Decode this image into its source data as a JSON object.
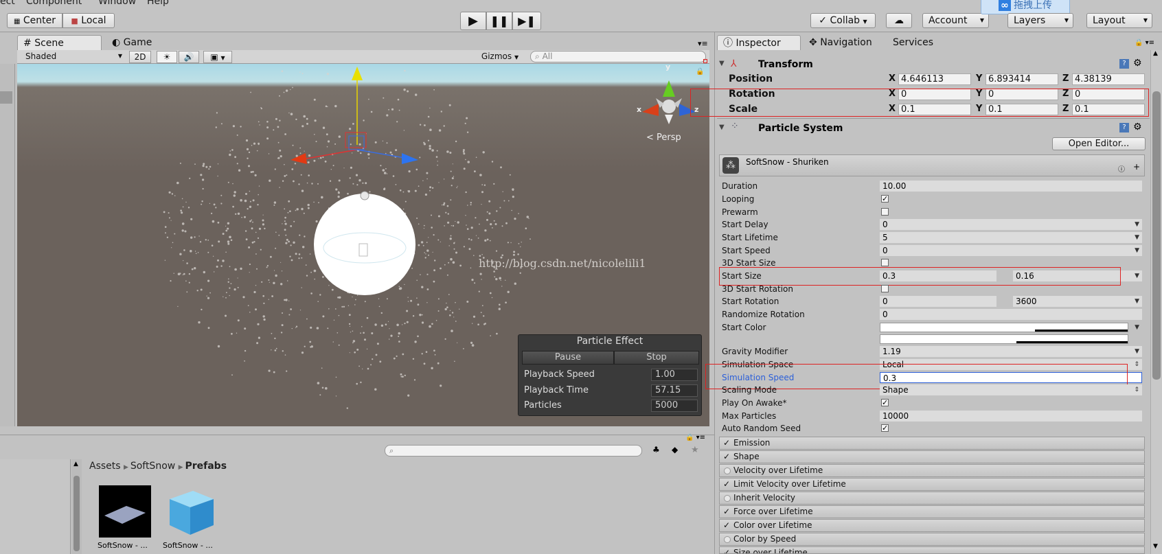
{
  "menubar": {
    "items": [
      "ect",
      "Component",
      "Window",
      "Help"
    ]
  },
  "toolbar": {
    "center_label": "Center",
    "local_label": "Local",
    "collab_label": "Collab",
    "account_label": "Account",
    "layers_label": "Layers",
    "layout_label": "Layout",
    "upload_overlay": "拖拽上传"
  },
  "scene_panel": {
    "tabs": {
      "scene": "Scene",
      "game": "Game"
    },
    "shading": "Shaded",
    "mode_2d": "2D",
    "gizmos": "Gizmos",
    "search_placeholder": "All",
    "persp_label": "Persp",
    "axis_x": "x",
    "axis_y": "y",
    "axis_z": "z",
    "watermark": "http://blog.csdn.net/nicolelili1"
  },
  "particle_effect": {
    "title": "Particle Effect",
    "pause": "Pause",
    "stop": "Stop",
    "rows": [
      {
        "label": "Playback Speed",
        "value": "1.00"
      },
      {
        "label": "Playback Time",
        "value": "57.15"
      },
      {
        "label": "Particles",
        "value": "5000"
      }
    ]
  },
  "project": {
    "breadcrumb": [
      "Assets",
      "SoftSnow",
      "Prefabs"
    ],
    "assets": [
      {
        "name": "SoftSnow - ..."
      },
      {
        "name": "SoftSnow - ..."
      }
    ]
  },
  "inspector": {
    "tabs": {
      "inspector": "Inspector",
      "navigation": "Navigation",
      "services": "Services"
    },
    "transform": {
      "title": "Transform",
      "rows": [
        {
          "label": "Position",
          "x": "4.646113",
          "y": "6.893414",
          "z": "4.38139"
        },
        {
          "label": "Rotation",
          "x": "0",
          "y": "0",
          "z": "0"
        },
        {
          "label": "Scale",
          "x": "0.1",
          "y": "0.1",
          "z": "0.1"
        }
      ]
    },
    "particle_system": {
      "title": "Particle System",
      "open_editor": "Open Editor...",
      "subheader": "SoftSnow - Shuriken",
      "duration": {
        "label": "Duration",
        "value": "10.00"
      },
      "looping": {
        "label": "Looping"
      },
      "prewarm": {
        "label": "Prewarm"
      },
      "start_delay": {
        "label": "Start Delay",
        "value": "0"
      },
      "start_lifetime": {
        "label": "Start Lifetime",
        "value": "5"
      },
      "start_speed": {
        "label": "Start Speed",
        "value": "0"
      },
      "start_size_3d": {
        "label": "3D Start Size"
      },
      "start_size": {
        "label": "Start Size",
        "min": "0.3",
        "max": "0.16"
      },
      "start_rotation_3d": {
        "label": "3D Start Rotation"
      },
      "start_rotation": {
        "label": "Start Rotation",
        "min": "0",
        "max": "3600"
      },
      "randomize_rotation": {
        "label": "Randomize Rotation",
        "value": "0"
      },
      "start_color": {
        "label": "Start Color"
      },
      "gravity_modifier": {
        "label": "Gravity Modifier",
        "value": "1.19"
      },
      "simulation_space": {
        "label": "Simulation Space",
        "value": "Local"
      },
      "simulation_speed": {
        "label": "Simulation Speed",
        "value": "0.3"
      },
      "scaling_mode": {
        "label": "Scaling Mode",
        "value": "Shape"
      },
      "play_on_awake": {
        "label": "Play On Awake*"
      },
      "max_particles": {
        "label": "Max Particles",
        "value": "10000"
      },
      "auto_random_seed": {
        "label": "Auto Random Seed"
      },
      "modules": [
        {
          "label": "Emission",
          "enabled": true
        },
        {
          "label": "Shape",
          "enabled": true
        },
        {
          "label": "Velocity over Lifetime",
          "enabled": false
        },
        {
          "label": "Limit Velocity over Lifetime",
          "enabled": true
        },
        {
          "label": "Inherit Velocity",
          "enabled": false
        },
        {
          "label": "Force over Lifetime",
          "enabled": true
        },
        {
          "label": "Color over Lifetime",
          "enabled": true
        },
        {
          "label": "Color by Speed",
          "enabled": false
        },
        {
          "label": "Size over Lifetime",
          "enabled": true
        }
      ]
    }
  },
  "colors": {
    "accent_blue": "#2b5fd9",
    "highlight_red": "#d22222",
    "scene_bg": "#6b625c"
  }
}
